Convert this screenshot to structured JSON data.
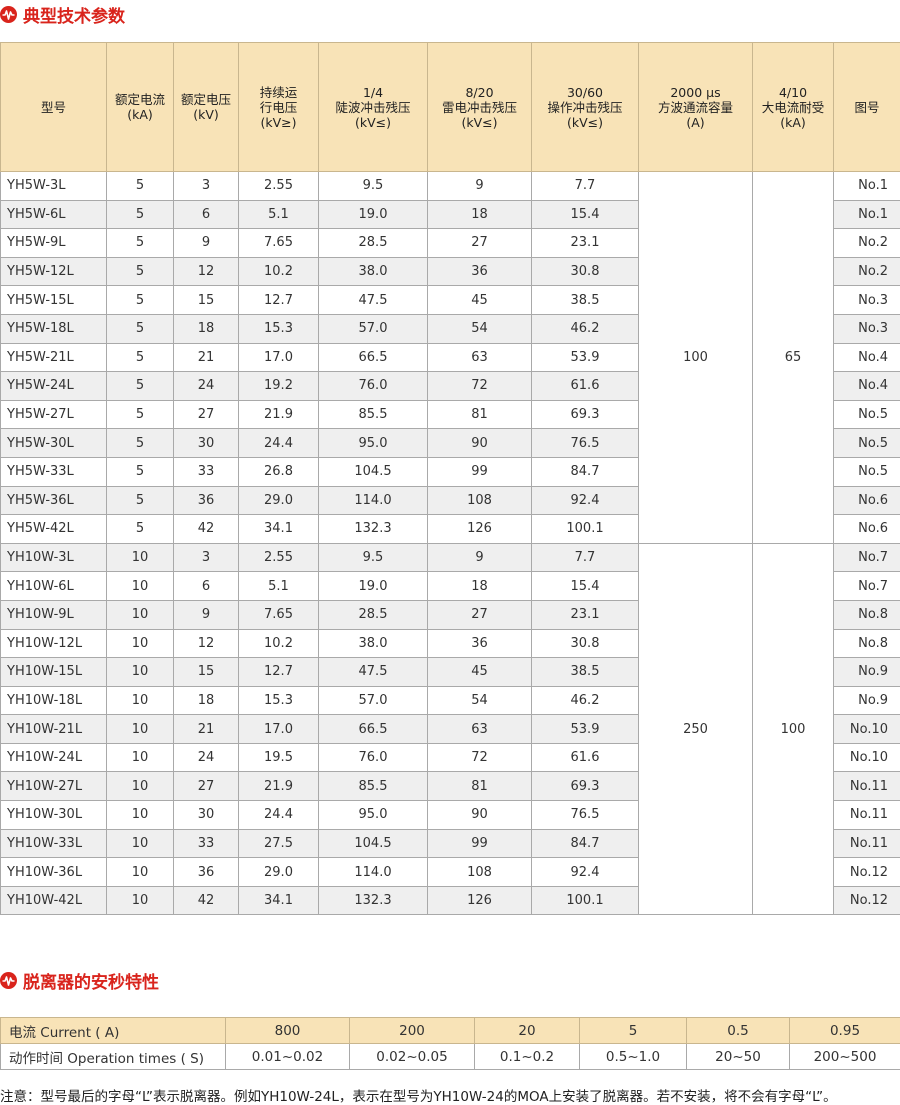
{
  "sections": {
    "spec_title": "典型技术参数",
    "release_title": "脱离器的安秒特性"
  },
  "spec_table": {
    "headers": [
      "型号",
      "额定电流\n(kA)",
      "额定电压\n(kV)",
      "持续运\n行电压\n(kV≥)",
      "1/4\n陡波冲击残压\n(kV≤)",
      "8/20\n雷电冲击残压\n(kV≤)",
      "30/60\n操作冲击残压\n(kV≤)",
      "2000 μs\n方波通流容量\n(A)",
      "4/10\n大电流耐受\n(kA)",
      "图号"
    ],
    "groups": [
      {
        "square_wave": "100",
        "high_current": "65"
      },
      {
        "square_wave": "250",
        "high_current": "100"
      }
    ],
    "rows": [
      [
        "YH5W-3L",
        "5",
        "3",
        "2.55",
        "9.5",
        "9",
        "7.7",
        "No.1"
      ],
      [
        "YH5W-6L",
        "5",
        "6",
        "5.1",
        "19.0",
        "18",
        "15.4",
        "No.1"
      ],
      [
        "YH5W-9L",
        "5",
        "9",
        "7.65",
        "28.5",
        "27",
        "23.1",
        "No.2"
      ],
      [
        "YH5W-12L",
        "5",
        "12",
        "10.2",
        "38.0",
        "36",
        "30.8",
        "No.2"
      ],
      [
        "YH5W-15L",
        "5",
        "15",
        "12.7",
        "47.5",
        "45",
        "38.5",
        "No.3"
      ],
      [
        "YH5W-18L",
        "5",
        "18",
        "15.3",
        "57.0",
        "54",
        "46.2",
        "No.3"
      ],
      [
        "YH5W-21L",
        "5",
        "21",
        "17.0",
        "66.5",
        "63",
        "53.9",
        "No.4"
      ],
      [
        "YH5W-24L",
        "5",
        "24",
        "19.2",
        "76.0",
        "72",
        "61.6",
        "No.4"
      ],
      [
        "YH5W-27L",
        "5",
        "27",
        "21.9",
        "85.5",
        "81",
        "69.3",
        "No.5"
      ],
      [
        "YH5W-30L",
        "5",
        "30",
        "24.4",
        "95.0",
        "90",
        "76.5",
        "No.5"
      ],
      [
        "YH5W-33L",
        "5",
        "33",
        "26.8",
        "104.5",
        "99",
        "84.7",
        "No.5"
      ],
      [
        "YH5W-36L",
        "5",
        "36",
        "29.0",
        "114.0",
        "108",
        "92.4",
        "No.6"
      ],
      [
        "YH5W-42L",
        "5",
        "42",
        "34.1",
        "132.3",
        "126",
        "100.1",
        "No.6"
      ],
      [
        "YH10W-3L",
        "10",
        "3",
        "2.55",
        "9.5",
        "9",
        "7.7",
        "No.7"
      ],
      [
        "YH10W-6L",
        "10",
        "6",
        "5.1",
        "19.0",
        "18",
        "15.4",
        "No.7"
      ],
      [
        "YH10W-9L",
        "10",
        "9",
        "7.65",
        "28.5",
        "27",
        "23.1",
        "No.8"
      ],
      [
        "YH10W-12L",
        "10",
        "12",
        "10.2",
        "38.0",
        "36",
        "30.8",
        "No.8"
      ],
      [
        "YH10W-15L",
        "10",
        "15",
        "12.7",
        "47.5",
        "45",
        "38.5",
        "No.9"
      ],
      [
        "YH10W-18L",
        "10",
        "18",
        "15.3",
        "57.0",
        "54",
        "46.2",
        "No.9"
      ],
      [
        "YH10W-21L",
        "10",
        "21",
        "17.0",
        "66.5",
        "63",
        "53.9",
        "No.10"
      ],
      [
        "YH10W-24L",
        "10",
        "24",
        "19.5",
        "76.0",
        "72",
        "61.6",
        "No.10"
      ],
      [
        "YH10W-27L",
        "10",
        "27",
        "21.9",
        "85.5",
        "81",
        "69.3",
        "No.11"
      ],
      [
        "YH10W-30L",
        "10",
        "30",
        "24.4",
        "95.0",
        "90",
        "76.5",
        "No.11"
      ],
      [
        "YH10W-33L",
        "10",
        "33",
        "27.5",
        "104.5",
        "99",
        "84.7",
        "No.11"
      ],
      [
        "YH10W-36L",
        "10",
        "36",
        "29.0",
        "114.0",
        "108",
        "92.4",
        "No.12"
      ],
      [
        "YH10W-42L",
        "10",
        "42",
        "34.1",
        "132.3",
        "126",
        "100.1",
        "No.12"
      ]
    ]
  },
  "release_table": {
    "current_label": "电流 Current ( A)",
    "time_label": "动作时间 Operation times ( S)",
    "currents": [
      "800",
      "200",
      "20",
      "5",
      "0.5",
      "0.95"
    ],
    "times": [
      "0.01~0.02",
      "0.02~0.05",
      "0.1~0.2",
      "0.5~1.0",
      "20~50",
      "200~500"
    ]
  },
  "note": "注意：型号最后的字母“L”表示脱离器。例如YH10W-24L，表示在型号为YH10W-24的MOA上安装了脱离器。若不安装，将不会有字母“L”。",
  "colors": {
    "accent": "#d9241c",
    "header_bg": "#f8e3b7",
    "stripe": "#efefef"
  },
  "icons": {
    "section_marker": "pulse-wave-icon"
  }
}
